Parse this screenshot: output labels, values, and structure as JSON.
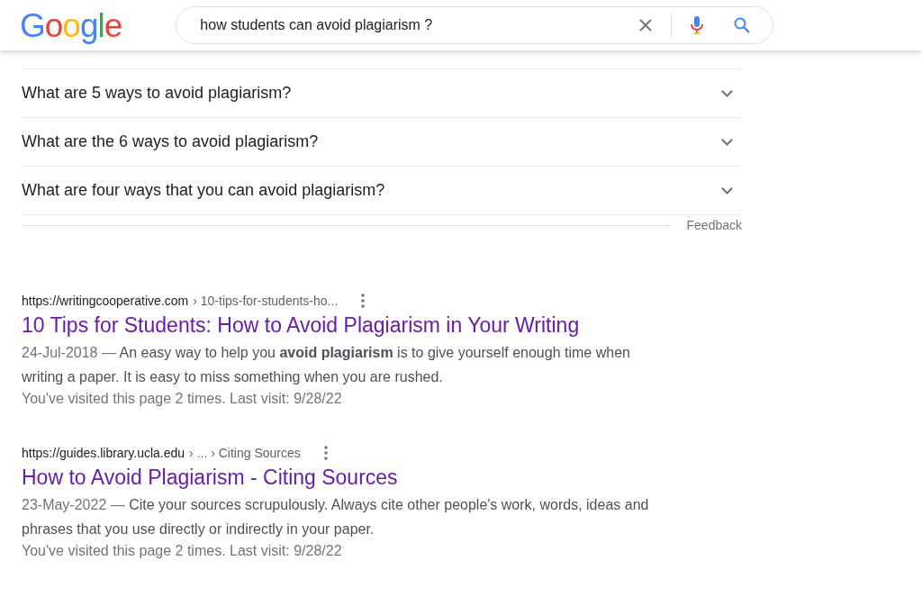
{
  "header": {
    "logo": "Google",
    "search": {
      "value": "how students can avoid plagiarism ?"
    }
  },
  "people_also_ask": {
    "questions": [
      {
        "text": "What are 5 ways to avoid plagiarism?",
        "expanded": false
      },
      {
        "text": "What are the 6 ways to avoid plagiarism?",
        "expanded": false
      },
      {
        "text": "What are four ways that you can avoid plagiarism?",
        "expanded": false
      }
    ],
    "feedback": "Feedback"
  },
  "results": [
    {
      "url": "https://writingcooperative.com",
      "path": "› 10-tips-for-students-ho...",
      "title": "10 Tips for Students: How to Avoid Plagiarism in Your Writing",
      "visited": true,
      "date": "24-Jul-2018 —",
      "snippet": "An easy way to help you **avoid plagiarism** is to give yourself enough time when writing a paper. It is easy to miss something when you are rushed.",
      "visit_note": "You've visited this page 2 times. Last visit: 9/28/22"
    },
    {
      "url": "https://guides.library.ucla.edu",
      "path": "› ... › Citing Sources",
      "title": "How to Avoid Plagiarism - Citing Sources",
      "visited": true,
      "date": "23-May-2022 —",
      "snippet": "Cite your sources scrupulously. Always cite other people's work, words, ideas and phrases that you use directly or indirectly in your paper.",
      "visit_note": "You've visited this page 2 times. Last visit: 9/28/22"
    }
  ]
}
